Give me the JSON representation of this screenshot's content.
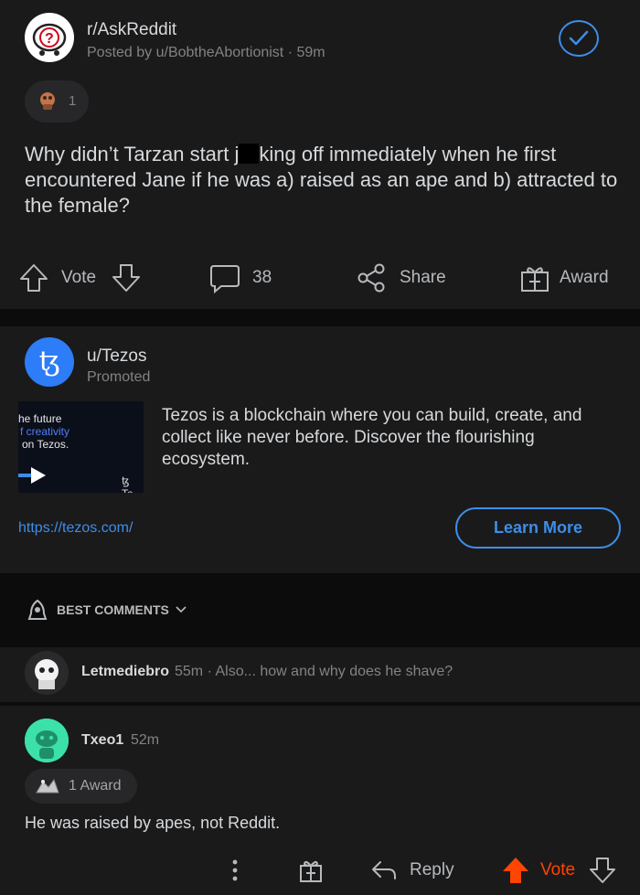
{
  "post": {
    "subreddit": "r/AskReddit",
    "posted_by": "Posted by u/BobtheAbortionist · 59m",
    "award_count": "1",
    "title_part1": "Why didn’t Tarzan start j",
    "title_part2": "king off immediately when he first encountered Jane if he was a) raised as an ape and b) attracted to the female?",
    "actions": {
      "vote_label": "Vote",
      "comments_count": "38",
      "share_label": "Share",
      "award_label": "Award"
    }
  },
  "ad": {
    "user": "u/Tezos",
    "promoted": "Promoted",
    "thumb_line1": "he future",
    "thumb_line2": "f creativity",
    "thumb_line3": "on Tezos.",
    "thumb_brand": "ꜩ Te",
    "body": "Tezos is a blockchain where you can build, create, and collect like never before. Discover the flourishing ecosystem.",
    "link": "https://tezos.com/",
    "cta": "Learn More"
  },
  "comments": {
    "sort_label": "BEST COMMENTS",
    "first": {
      "user": "Letmediebro",
      "meta": "55m · Also... how and why does he shave?"
    },
    "second": {
      "user": "Txeo1",
      "time": "52m",
      "award": "1 Award",
      "body": "He was raised by apes, not Reddit.",
      "reply_label": "Reply",
      "vote_label": "Vote"
    }
  },
  "colors": {
    "accent": "#3d8ee8",
    "upvote": "#ff4500",
    "background": "#0c0c0d",
    "card": "#1a1a1b"
  },
  "icons": [
    "askreddit-logo",
    "check-circle-icon",
    "award-icon",
    "upvote-icon",
    "downvote-icon",
    "comment-icon",
    "share-icon",
    "gift-icon",
    "tezos-logo",
    "play-icon",
    "rocket-icon",
    "chevron-down-icon",
    "more-icon",
    "reply-icon"
  ]
}
